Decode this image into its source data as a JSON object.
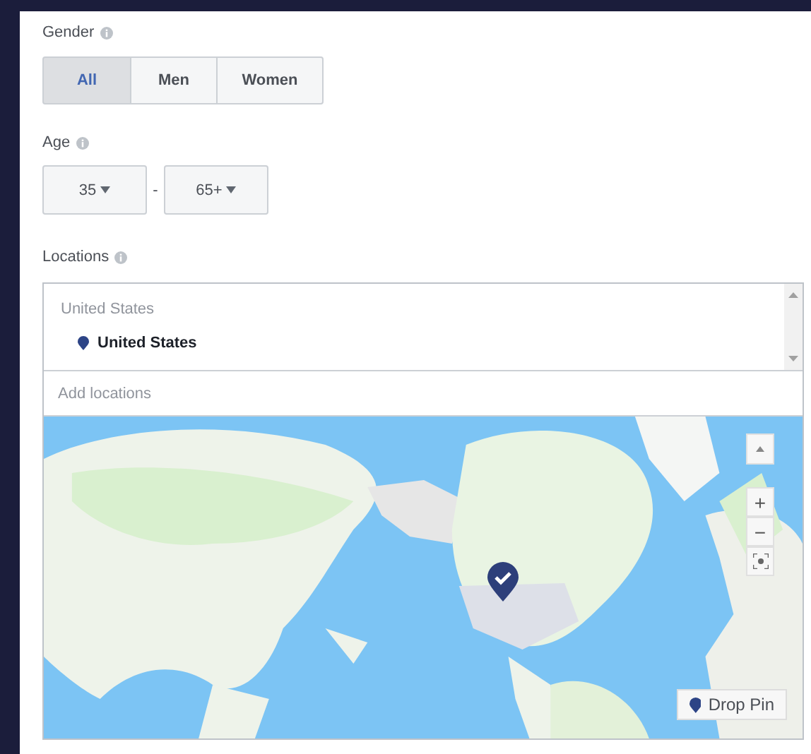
{
  "gender": {
    "label": "Gender",
    "options": [
      {
        "label": "All",
        "selected": true
      },
      {
        "label": "Men",
        "selected": false
      },
      {
        "label": "Women",
        "selected": false
      }
    ]
  },
  "age": {
    "label": "Age",
    "min": "35",
    "separator": "-",
    "max": "65+"
  },
  "locations": {
    "label": "Locations",
    "group": "United States",
    "items": [
      {
        "name": "United States"
      }
    ],
    "placeholder": "Add locations"
  },
  "map": {
    "kind": "picture",
    "controls": {
      "zoom_in": "+",
      "zoom_out": "−"
    },
    "drop_pin": "Drop Pin"
  }
}
